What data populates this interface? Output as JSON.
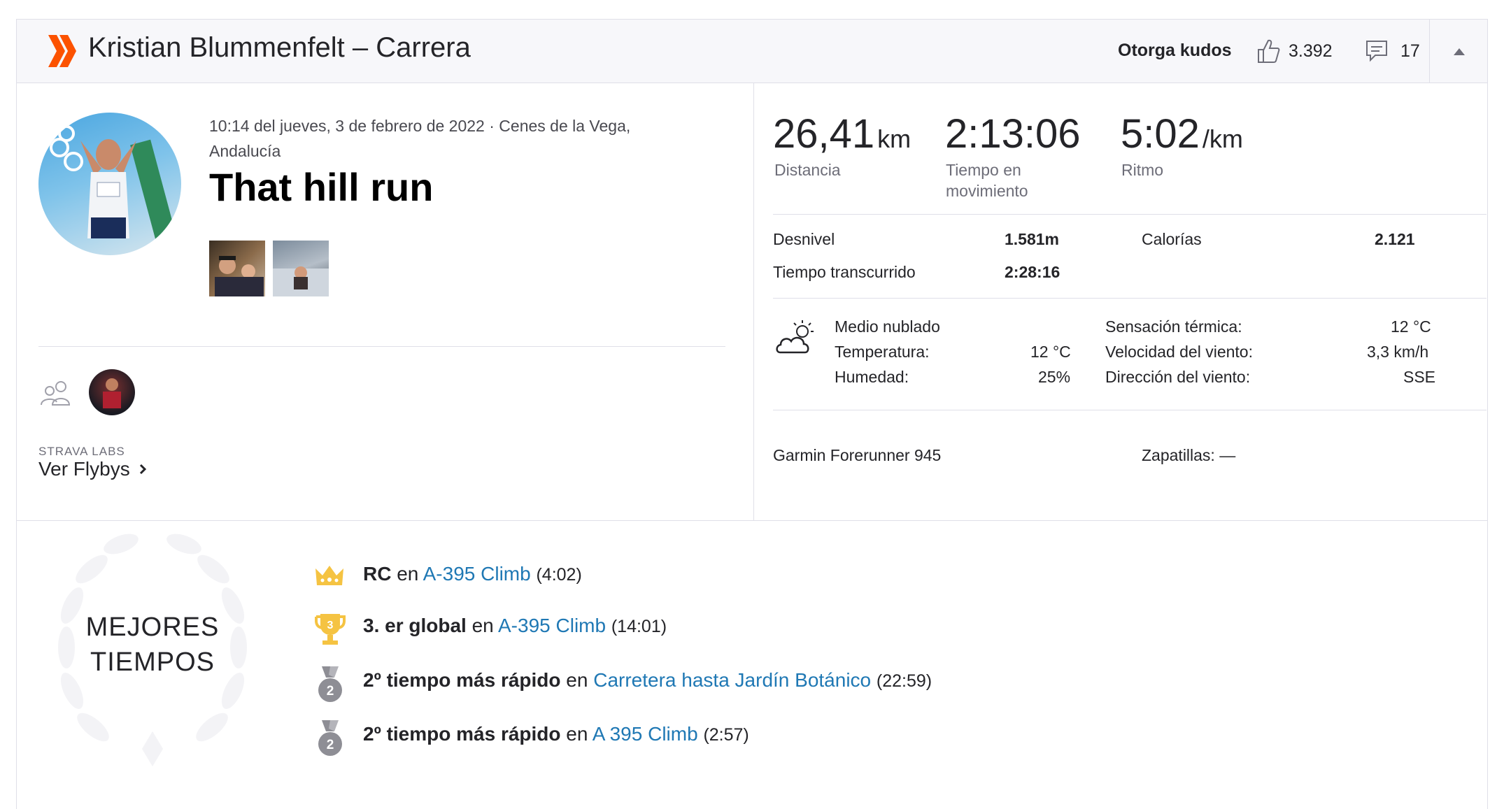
{
  "header": {
    "title": "Kristian Blummenfelt – Carrera",
    "kudos_label": "Otorga kudos",
    "kudos_count": "3.392",
    "comments_count": "17",
    "brand_color": "#fc5200"
  },
  "activity": {
    "date_location": "10:14 del jueves, 3 de febrero de 2022 · Cenes de la Vega, Andalucía",
    "name": "That hill run",
    "photos": [
      "photo-1",
      "photo-2"
    ]
  },
  "social": {
    "strava_labs": "STRAVA LABS",
    "flybys_label": "Ver Flybys"
  },
  "stats": {
    "distance": {
      "value": "26,41",
      "unit": "km",
      "label": "Distancia"
    },
    "moving_time": {
      "value": "2:13:06",
      "label": "Tiempo en movimiento"
    },
    "pace": {
      "value": "5:02",
      "unit": "/km",
      "label": "Ritmo"
    },
    "elevation": {
      "label": "Desnivel",
      "value": "1.581m"
    },
    "calories": {
      "label": "Calorías",
      "value": "2.121"
    },
    "elapsed": {
      "label": "Tiempo transcurrido",
      "value": "2:28:16"
    }
  },
  "weather": {
    "condition": "Medio nublado",
    "temperature_label": "Temperatura:",
    "temperature": "12 °C",
    "humidity_label": "Humedad:",
    "humidity": "25%",
    "feels_like_label": "Sensación térmica:",
    "feels_like": "12 °C",
    "wind_speed_label": "Velocidad del viento:",
    "wind_speed": "3,3 km/h",
    "wind_dir_label": "Dirección del viento:",
    "wind_dir": "SSE"
  },
  "device": {
    "name": "Garmin Forerunner 945",
    "shoes_label": "Zapatillas: —"
  },
  "achievements": {
    "title_line1": "MEJORES",
    "title_line2": "TIEMPOS",
    "items": [
      {
        "bold": "RC",
        "en": "en",
        "segment": "A-395 Climb",
        "time": "(4:02)",
        "icon": "crown-icon"
      },
      {
        "bold": "3. er global",
        "en": "en",
        "segment": "A-395 Climb",
        "time": "(14:01)",
        "icon": "trophy-icon",
        "rank": "3"
      },
      {
        "bold": "2º tiempo más rápido",
        "en": "en",
        "segment": "Carretera hasta Jardín Botánico",
        "time": "(22:59)",
        "icon": "medal-icon",
        "rank": "2"
      },
      {
        "bold": "2º tiempo más rápido",
        "en": "en",
        "segment": "A 395 Climb",
        "time": "(2:57)",
        "icon": "medal-icon",
        "rank": "2"
      }
    ]
  }
}
